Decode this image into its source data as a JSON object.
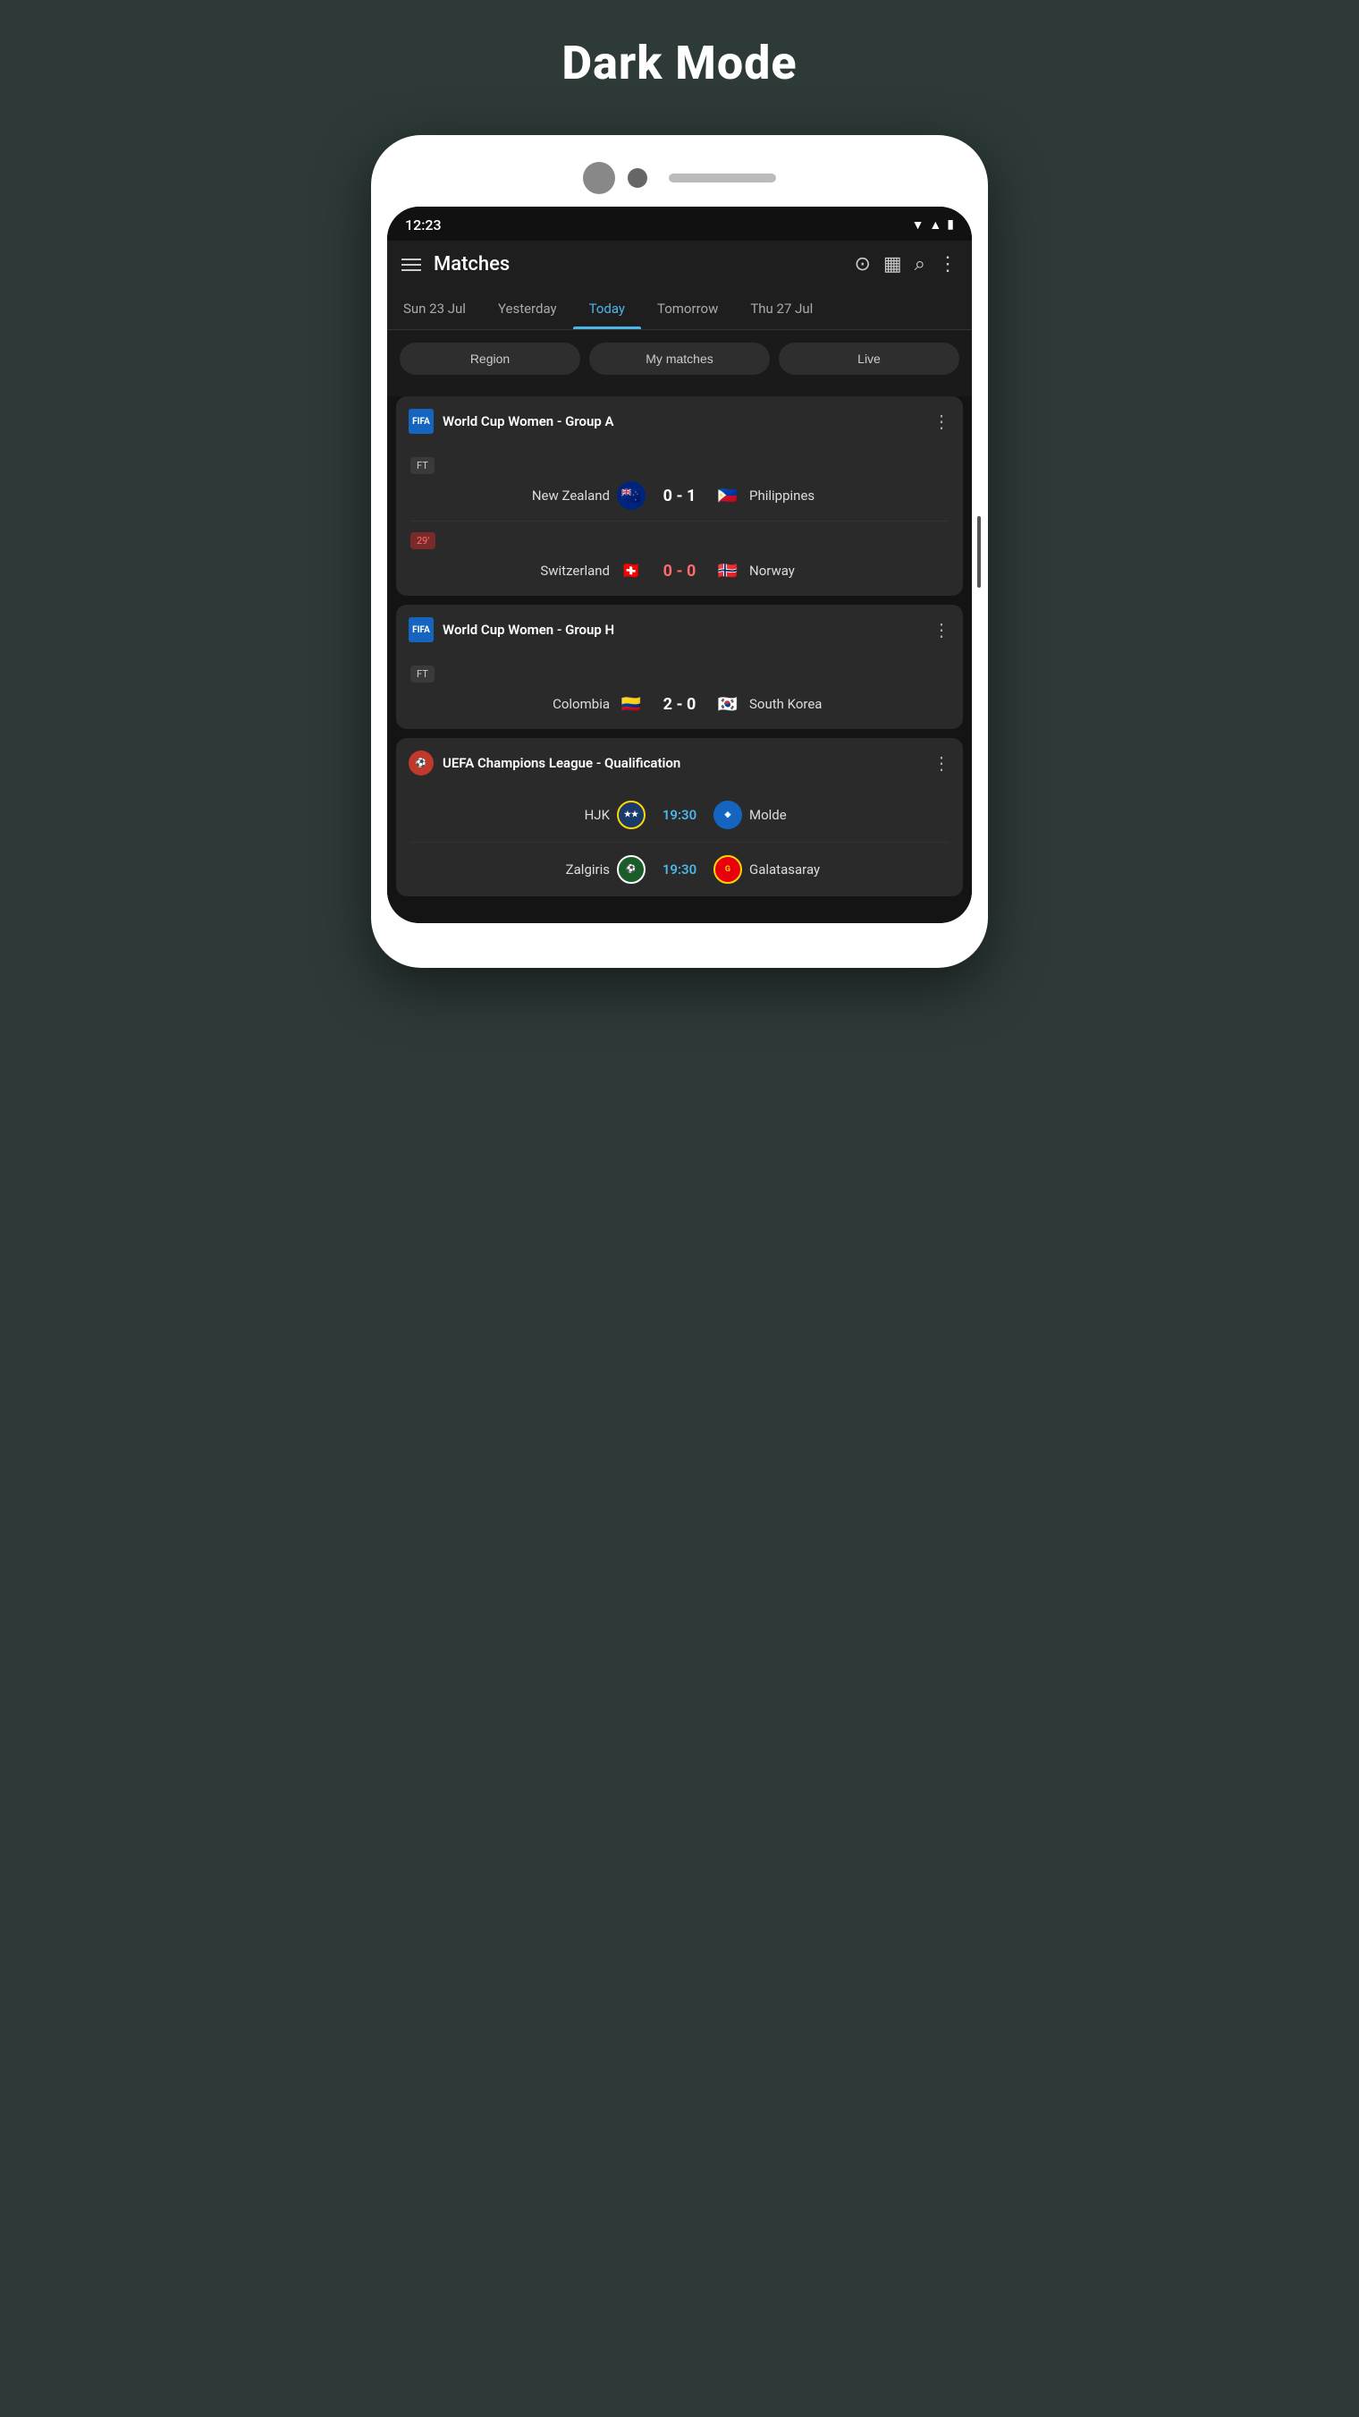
{
  "page": {
    "title": "Dark Mode"
  },
  "status_bar": {
    "time": "12:23"
  },
  "app_bar": {
    "title": "Matches"
  },
  "tabs": [
    {
      "label": "Sun 23 Jul",
      "active": false
    },
    {
      "label": "Yesterday",
      "active": false
    },
    {
      "label": "Today",
      "active": true
    },
    {
      "label": "Tomorrow",
      "active": false
    },
    {
      "label": "Thu 27 Jul",
      "active": false
    }
  ],
  "filters": [
    {
      "label": "Region"
    },
    {
      "label": "My matches"
    },
    {
      "label": "Live"
    }
  ],
  "sections": [
    {
      "id": "group-a",
      "league": "World Cup Women - Group A",
      "logo_type": "fifa",
      "matches": [
        {
          "status": "FT",
          "status_live": false,
          "team1": "New Zealand",
          "flag1": "🇳🇿",
          "score": "0 - 1",
          "score_live": false,
          "team2": "Philippines",
          "flag2": "🇵🇭"
        },
        {
          "status": "29'",
          "status_live": true,
          "team1": "Switzerland",
          "flag1": "🇨🇭",
          "score": "0 - 0",
          "score_live": true,
          "team2": "Norway",
          "flag2": "🇳🇴"
        }
      ]
    },
    {
      "id": "group-h",
      "league": "World Cup Women - Group H",
      "logo_type": "fifa",
      "matches": [
        {
          "status": "FT",
          "status_live": false,
          "team1": "Colombia",
          "flag1": "🇨🇴",
          "score": "2 - 0",
          "score_live": false,
          "team2": "South Korea",
          "flag2": "🇰🇷"
        }
      ]
    },
    {
      "id": "ucl-qual",
      "league": "UEFA Champions League - Qualification",
      "logo_type": "uefa",
      "matches": [
        {
          "status": "19:30",
          "status_live": false,
          "team1": "HJK",
          "logo1_type": "hjk",
          "score": "",
          "team2": "Molde",
          "logo2_type": "molde"
        },
        {
          "status": "19:30",
          "status_live": false,
          "team1": "Zalgiris",
          "logo1_type": "zalgiris",
          "score": "",
          "team2": "Galatasaray",
          "logo2_type": "galatasaray"
        }
      ]
    }
  ],
  "icons": {
    "hamburger": "☰",
    "clock": "🕐",
    "calendar": "📅",
    "search": "🔍",
    "more_vert": "⋮",
    "wifi": "▲",
    "signal": "▲",
    "battery": "🔋"
  }
}
